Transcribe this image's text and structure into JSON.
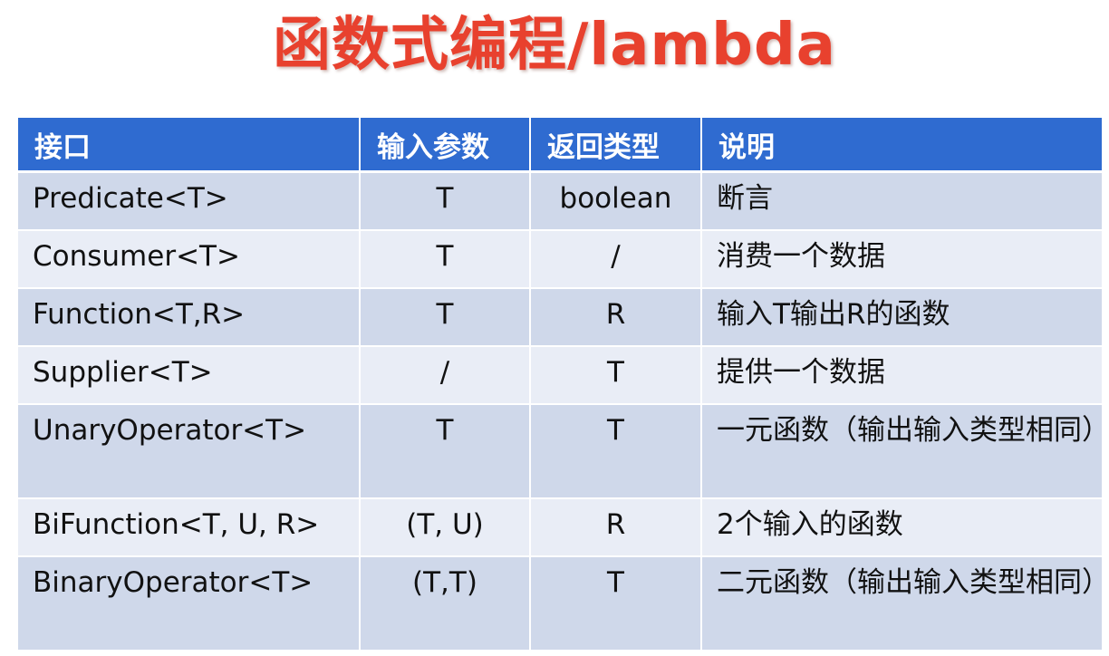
{
  "slide": {
    "title": "函数式编程/lambda"
  },
  "table": {
    "headers": [
      "接口",
      "输入参数",
      "返回类型",
      "说明"
    ],
    "rows": [
      {
        "interface": "Predicate<T>",
        "input": "T",
        "return": "boolean",
        "description": "断言"
      },
      {
        "interface": "Consumer<T>",
        "input": "T",
        "return": "/",
        "description": "消费一个数据"
      },
      {
        "interface": "Function<T,R>",
        "input": "T",
        "return": "R",
        "description": "输入T输出R的函数"
      },
      {
        "interface": "Supplier<T>",
        "input": "/",
        "return": "T",
        "description": "提供一个数据"
      },
      {
        "interface": "UnaryOperator<T>",
        "input": "T",
        "return": "T",
        "description": "一元函数（输出输入类型相同）"
      },
      {
        "interface": "BiFunction<T, U, R>",
        "input": "(T, U)",
        "return": "R",
        "description": "2个输入的函数"
      },
      {
        "interface": "BinaryOperator<T>",
        "input": "(T,T)",
        "return": "T",
        "description": "二元函数（输出输入类型相同）"
      }
    ]
  },
  "colors": {
    "title": "#e8412e",
    "header_bg": "#2f6bd0",
    "row_dark": "#cfd8ea",
    "row_light": "#e9edf6"
  }
}
